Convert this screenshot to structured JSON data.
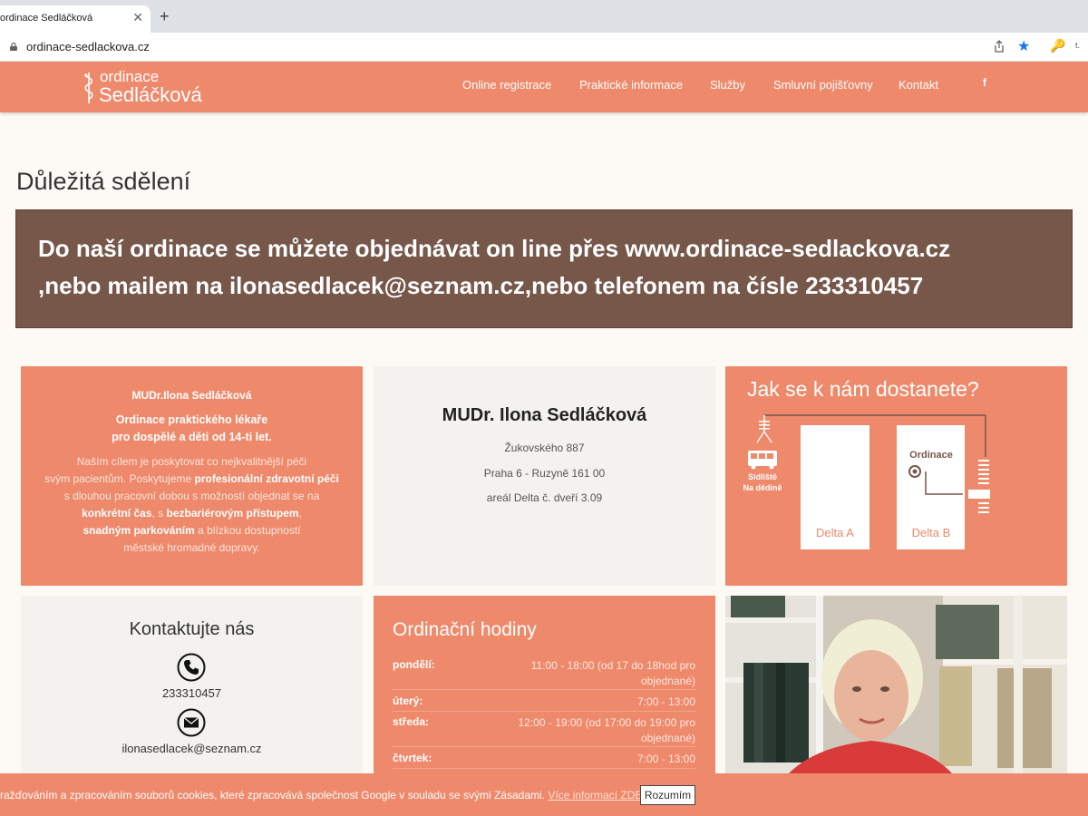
{
  "browser": {
    "tab_title": "ordinace Sedláčková",
    "tab_close": "✕",
    "new_tab": "+",
    "url": "ordinace-sedlackova.cz",
    "ext_short": "t."
  },
  "header": {
    "logo_small": "ordinace",
    "logo_big": "Sedláčková",
    "nav": [
      "Online registrace",
      "Praktické informace",
      "Služby",
      "Smluvní pojišťovny",
      "Kontakt"
    ],
    "facebook": "f"
  },
  "heading": "Důležitá sdělení",
  "notice": {
    "line1": "Do naší  ordinace se můžete objednávat on line přes www.ordinace-sedlackova.cz",
    "line2": ",nebo mailem na ilonasedlacek@seznam.cz,nebo telefonem na čísle 233310457"
  },
  "about": {
    "name": "MUDr.Ilona Sedláčková",
    "sub1": "Ordinace praktického lékaře",
    "sub2": "pro dospělé a děti od 14-ti let.",
    "t1": "Naším cílem je poskytovat co nejkvalitnější péči",
    "t2a": "svým pacientům. Poskytujeme ",
    "t2b": "profesionální zdravotní péči",
    "t3": "s dlouhou pracovní dobou s možností objednat se na",
    "t4a": "konkrétní čas",
    "t4b": ", s ",
    "t4c": "bezbariérovým přístupem",
    "t4d": ",",
    "t5a": "snadným parkováním",
    "t5b": " a blízkou dostupností",
    "t6": "městské hromadné dopravy."
  },
  "address": {
    "name": "MUDr. Ilona Sedláčková",
    "street": "Žukovského 887",
    "city": "Praha 6 - Ruzyně 161 00",
    "area": "areál Delta č. dveří 3.09"
  },
  "map": {
    "title": "Jak se k nám dostanete?",
    "stop_line1": "Sídliště",
    "stop_line2": "Na dědině",
    "ordinace": "Ordinace",
    "building_a": "Delta A",
    "building_b": "Delta B"
  },
  "contact": {
    "title": "Kontaktujte nás",
    "phone": "233310457",
    "email": "ilonasedlacek@seznam.cz"
  },
  "hours": {
    "title": "Ordinační hodiny",
    "rows": [
      {
        "day": "pondělí:",
        "time1": "11:00 - 18:00 (od 17 do 18hod pro",
        "time2": "objednané)"
      },
      {
        "day": "úterý:",
        "time1": "7:00 - 13:00",
        "time2": ""
      },
      {
        "day": "středa:",
        "time1": "12:00 - 19:00 (od 17:00 do 19:00 pro",
        "time2": "objednané)"
      },
      {
        "day": "čtvrtek:",
        "time1": "7:00 - 13:00",
        "time2": ""
      }
    ]
  },
  "cookie": {
    "text": "ražďováním a zpracováním souborů cookies, které zpracovává společnost Google v souladu se svými Zásadami. ",
    "link": "Více informací ZDE.",
    "button": "Rozumím"
  },
  "colors": {
    "brand": "#ee896b",
    "notice_bg": "#76574a",
    "panel_light": "#f4f2ef"
  }
}
